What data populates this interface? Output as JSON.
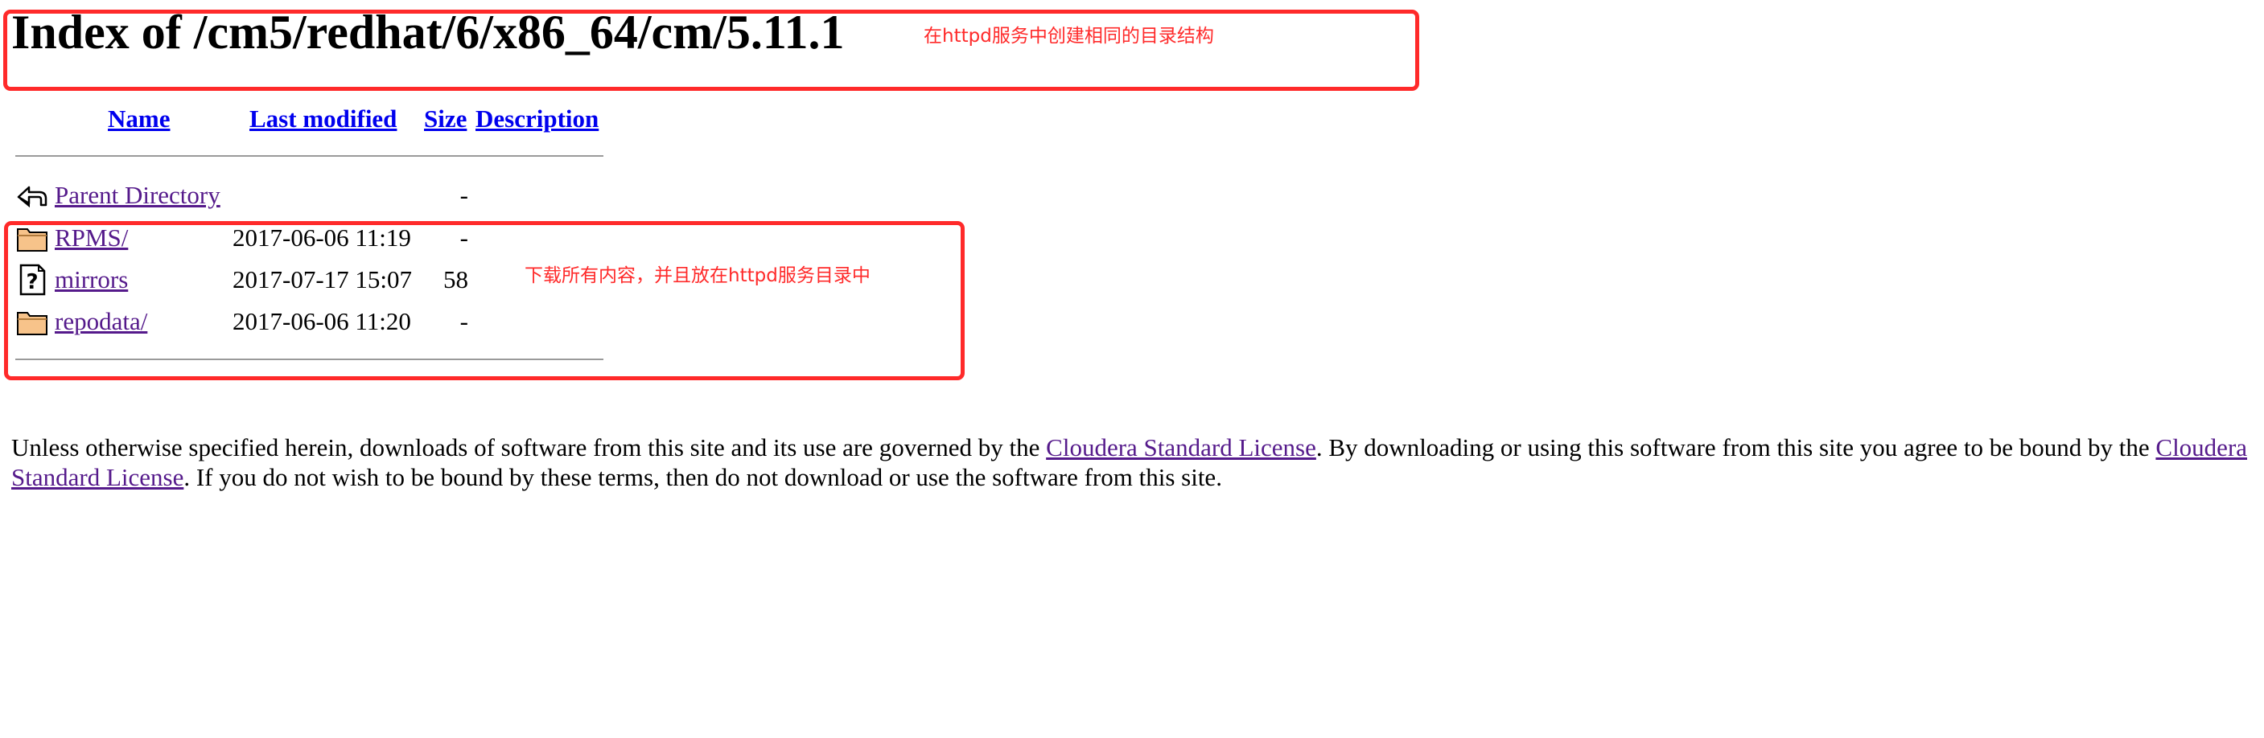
{
  "page": {
    "title": "Index of /cm5/redhat/6/x86_64/cm/5.11.1"
  },
  "annotations": {
    "title_note": "在httpd服务中创建相同的目录结构",
    "list_note": "下载所有内容，并且放在httpd服务目录中",
    "box_color": "#ff2a2a"
  },
  "table": {
    "headers": {
      "name": "Name",
      "modified": "Last modified",
      "size": "Size",
      "description": "Description"
    },
    "rows": [
      {
        "name": "Parent Directory",
        "modified": "",
        "size": "-",
        "icon": "back-arrow-icon"
      },
      {
        "name": "RPMS/",
        "modified": "2017-06-06 11:19",
        "size": "-",
        "icon": "folder-icon"
      },
      {
        "name": "mirrors",
        "modified": "2017-07-17 15:07",
        "size": "58",
        "icon": "unknown-file-icon"
      },
      {
        "name": "repodata/",
        "modified": "2017-06-06 11:20",
        "size": "-",
        "icon": "folder-icon"
      }
    ]
  },
  "license": {
    "text1": "Unless otherwise specified herein, downloads of software from this site and its use are governed by the ",
    "link1": "Cloudera Standard License",
    "text2": ". By downloading or using this software from this site you agree to be bound by the ",
    "link2": "Cloudera Standard License",
    "text3": ". If you do not wish to be bound by these terms, then do not download or use the software from this site."
  },
  "colors": {
    "link_visited": "#551a8b",
    "link_header": "#0000ee",
    "folder_fill": "#f7c38a"
  }
}
